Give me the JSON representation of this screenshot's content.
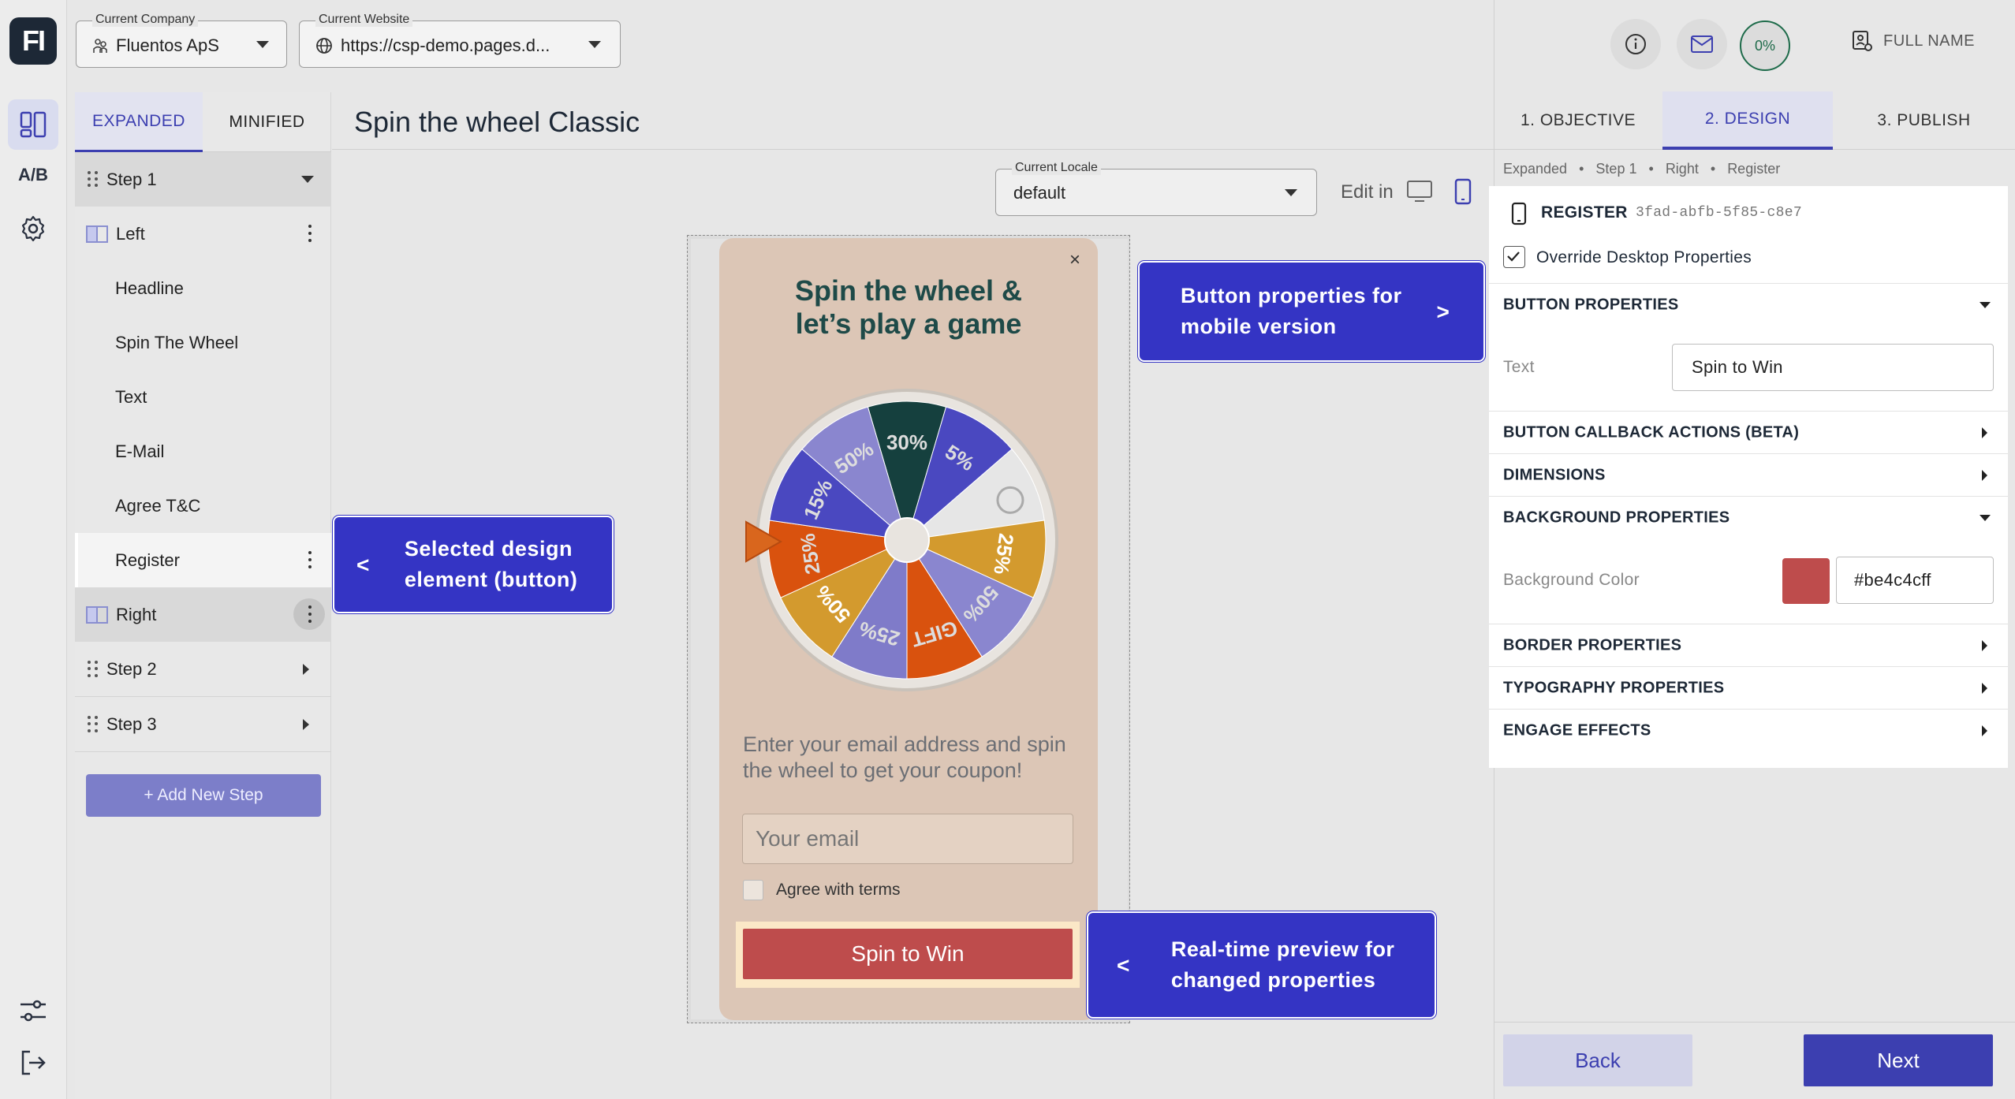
{
  "app": {
    "logo_text": "FI",
    "rail": {
      "ab_label": "A/B"
    }
  },
  "topbar": {
    "company": {
      "label": "Current Company",
      "value": "Fluentos ApS"
    },
    "website": {
      "label": "Current Website",
      "value": "https://csp-demo.pages.d..."
    }
  },
  "steps_panel": {
    "tabs": [
      "EXPANDED",
      "MINIFIED"
    ],
    "items": {
      "step1": "Step 1",
      "left": "Left",
      "headline": "Headline",
      "spin_the_wheel": "Spin The Wheel",
      "text": "Text",
      "email": "E-Mail",
      "agree": "Agree T&C",
      "register": "Register",
      "right": "Right",
      "step2": "Step 2",
      "step3": "Step 3"
    },
    "add_step_label": "+ Add New Step"
  },
  "canvas": {
    "title": "Spin the wheel Classic",
    "locale": {
      "label": "Current Locale",
      "value": "default"
    },
    "edit_in_label": "Edit in"
  },
  "preview": {
    "close": "×",
    "headline_line1": "Spin the wheel &",
    "headline_line2": "let’s play a game",
    "wheel_segments": [
      "30%",
      "5%",
      "",
      "25%",
      "50%",
      "GIFT",
      "25%",
      "50%",
      "25%",
      "15%",
      "50%"
    ],
    "description": "Enter your email address and spin the wheel to get your coupon!",
    "email_placeholder": "Your email",
    "agree_label": "Agree with terms",
    "button_label": "Spin to Win",
    "button_color": "#be4c4c"
  },
  "callouts": {
    "selected_element": {
      "arrow": "<",
      "line1": "Selected design",
      "line2": "element (button)"
    },
    "button_properties": {
      "arrow": ">",
      "line1": "Button properties for",
      "line2": "mobile version"
    },
    "realtime_preview": {
      "arrow": "<",
      "line1": "Real-time preview for",
      "line2": "changed properties"
    }
  },
  "right_panel": {
    "progress": "0%",
    "user_name": "FULL NAME",
    "tabs": [
      "1. OBJECTIVE",
      "2. DESIGN",
      "3. PUBLISH"
    ],
    "breadcrumb": [
      "Expanded",
      "Step 1",
      "Right",
      "Register"
    ],
    "element": {
      "type": "REGISTER",
      "id": "3fad-abfb-5f85-c8e7"
    },
    "override_label": "Override Desktop Properties",
    "override_checked": true,
    "sections": {
      "button_properties": "BUTTON PROPERTIES",
      "callback": "BUTTON CALLBACK ACTIONS (BETA)",
      "dimensions": "DIMENSIONS",
      "background": "BACKGROUND PROPERTIES",
      "border": "BORDER PROPERTIES",
      "typography": "TYPOGRAPHY PROPERTIES",
      "engage": "ENGAGE EFFECTS"
    },
    "text_field": {
      "label": "Text",
      "value": "Spin to Win"
    },
    "bg_field": {
      "label": "Background Color",
      "value": "#be4c4cff",
      "swatch": "#be4c4c"
    },
    "back_label": "Back",
    "next_label": "Next"
  }
}
